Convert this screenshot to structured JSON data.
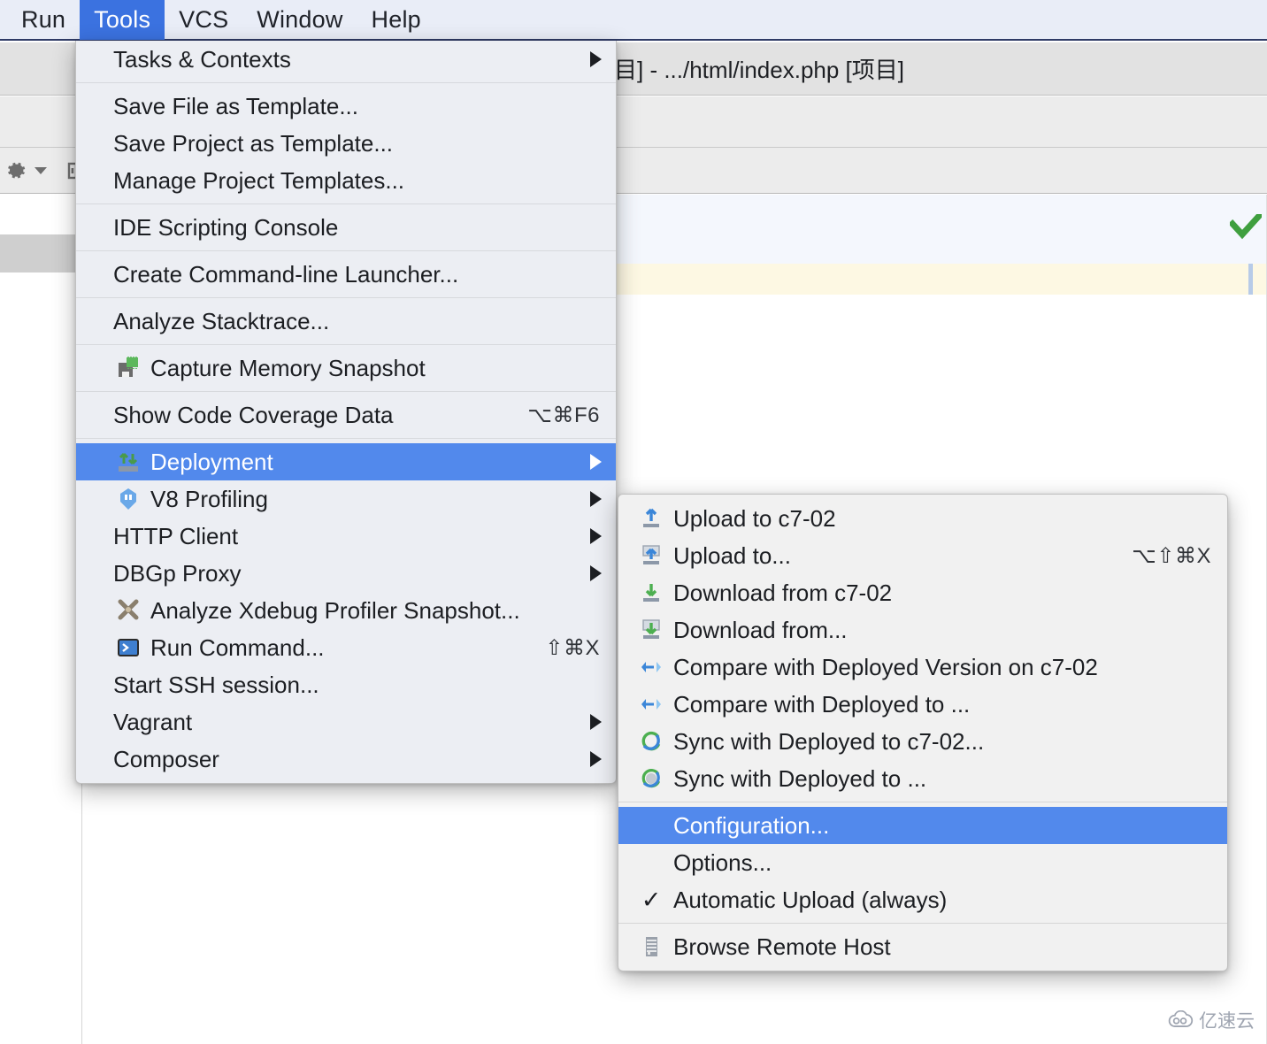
{
  "window": {
    "title_fragment": "目] - .../html/index.php [项目]"
  },
  "menubar": {
    "items": [
      {
        "label": "Run",
        "active": false
      },
      {
        "label": "Tools",
        "active": true
      },
      {
        "label": "VCS",
        "active": false
      },
      {
        "label": "Window",
        "active": false
      },
      {
        "label": "Help",
        "active": false
      }
    ]
  },
  "toolbar": {
    "gear_icon": "gear-icon",
    "gear_dropdown_icon": "chevron-down-icon",
    "collapse_icon": "collapse-all-icon"
  },
  "editor": {
    "inspection_ok_icon": "green-check-icon"
  },
  "watermark": {
    "text": "亿速云",
    "icon": "cloud-logo-icon"
  },
  "tools_menu": {
    "name": "Tools",
    "groups": [
      [
        {
          "label": "Tasks & Contexts",
          "icon": null,
          "shortcut": "",
          "submenu": true,
          "selected": false,
          "check": false
        }
      ],
      [
        {
          "label": "Save File as Template...",
          "icon": null,
          "shortcut": "",
          "submenu": false,
          "selected": false,
          "check": false
        },
        {
          "label": "Save Project as Template...",
          "icon": null,
          "shortcut": "",
          "submenu": false,
          "selected": false,
          "check": false
        },
        {
          "label": "Manage Project Templates...",
          "icon": null,
          "shortcut": "",
          "submenu": false,
          "selected": false,
          "check": false
        }
      ],
      [
        {
          "label": "IDE Scripting Console",
          "icon": null,
          "shortcut": "",
          "submenu": false,
          "selected": false,
          "check": false
        }
      ],
      [
        {
          "label": "Create Command-line Launcher...",
          "icon": null,
          "shortcut": "",
          "submenu": false,
          "selected": false,
          "check": false
        }
      ],
      [
        {
          "label": "Analyze Stacktrace...",
          "icon": null,
          "shortcut": "",
          "submenu": false,
          "selected": false,
          "check": false
        }
      ],
      [
        {
          "label": "Capture Memory Snapshot",
          "icon": "memory-snapshot-icon",
          "shortcut": "",
          "submenu": false,
          "selected": false,
          "check": false
        }
      ],
      [
        {
          "label": "Show Code Coverage Data",
          "icon": null,
          "shortcut": "⌥⌘F6",
          "submenu": false,
          "selected": false,
          "check": false
        }
      ],
      [
        {
          "label": "Deployment",
          "icon": "deployment-icon",
          "shortcut": "",
          "submenu": true,
          "selected": true,
          "check": false
        },
        {
          "label": "V8 Profiling",
          "icon": "v8-profiling-icon",
          "shortcut": "",
          "submenu": true,
          "selected": false,
          "check": false
        },
        {
          "label": "HTTP Client",
          "icon": null,
          "shortcut": "",
          "submenu": true,
          "selected": false,
          "check": false
        },
        {
          "label": "DBGp Proxy",
          "icon": null,
          "shortcut": "",
          "submenu": true,
          "selected": false,
          "check": false
        },
        {
          "label": "Analyze Xdebug Profiler Snapshot...",
          "icon": "xdebug-icon",
          "shortcut": "",
          "submenu": false,
          "selected": false,
          "check": false
        },
        {
          "label": "Run Command...",
          "icon": "terminal-icon",
          "shortcut": "⇧⌘X",
          "submenu": false,
          "selected": false,
          "check": false
        },
        {
          "label": "Start SSH session...",
          "icon": null,
          "shortcut": "",
          "submenu": false,
          "selected": false,
          "check": false
        },
        {
          "label": "Vagrant",
          "icon": null,
          "shortcut": "",
          "submenu": true,
          "selected": false,
          "check": false
        },
        {
          "label": "Composer",
          "icon": null,
          "shortcut": "",
          "submenu": true,
          "selected": false,
          "check": false
        }
      ]
    ]
  },
  "deployment_submenu": {
    "name": "Deployment",
    "groups": [
      [
        {
          "label": "Upload to c7-02",
          "icon": "upload-icon",
          "shortcut": "",
          "submenu": false,
          "selected": false,
          "check": false
        },
        {
          "label": "Upload to...",
          "icon": "upload-to-icon",
          "shortcut": "⌥⇧⌘X",
          "submenu": false,
          "selected": false,
          "check": false
        },
        {
          "label": "Download from c7-02",
          "icon": "download-icon",
          "shortcut": "",
          "submenu": false,
          "selected": false,
          "check": false
        },
        {
          "label": "Download from...",
          "icon": "download-from-icon",
          "shortcut": "",
          "submenu": false,
          "selected": false,
          "check": false
        },
        {
          "label": "Compare with Deployed Version on c7-02",
          "icon": "compare-icon",
          "shortcut": "",
          "submenu": false,
          "selected": false,
          "check": false
        },
        {
          "label": "Compare with Deployed to ...",
          "icon": "compare-icon",
          "shortcut": "",
          "submenu": false,
          "selected": false,
          "check": false
        },
        {
          "label": "Sync with Deployed to c7-02...",
          "icon": "sync-icon",
          "shortcut": "",
          "submenu": false,
          "selected": false,
          "check": false
        },
        {
          "label": "Sync with Deployed to ...",
          "icon": "sync-alt-icon",
          "shortcut": "",
          "submenu": false,
          "selected": false,
          "check": false
        }
      ],
      [
        {
          "label": "Configuration...",
          "icon": null,
          "shortcut": "",
          "submenu": false,
          "selected": true,
          "check": false
        },
        {
          "label": "Options...",
          "icon": null,
          "shortcut": "",
          "submenu": false,
          "selected": false,
          "check": false
        },
        {
          "label": "Automatic Upload (always)",
          "icon": null,
          "shortcut": "",
          "submenu": false,
          "selected": false,
          "check": true
        }
      ],
      [
        {
          "label": "Browse Remote Host",
          "icon": "remote-host-icon",
          "shortcut": "",
          "submenu": false,
          "selected": false,
          "check": false
        }
      ]
    ]
  },
  "colors": {
    "menu_highlight": "#5289ec",
    "menubar_highlight": "#3b72e0",
    "menubar_bg": "#e9edf7",
    "menu_bg": "#f1f1f1",
    "tools_menu_bg": "#eceef3",
    "warn_line": "#fdf8e3",
    "selected_line": "#f4f7fd",
    "ok_check": "#3f9f3f"
  }
}
